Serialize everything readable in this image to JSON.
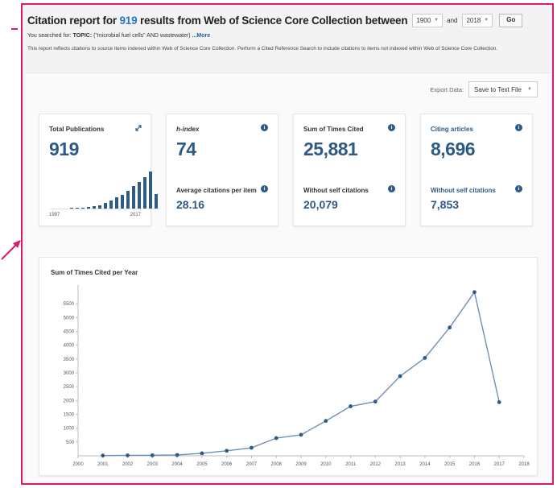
{
  "header": {
    "title_prefix": "Citation report for ",
    "result_count": "919",
    "title_suffix": " results from Web of Science Core Collection  between",
    "year_from": "1900",
    "and_label": "and",
    "year_to": "2018",
    "go_label": "Go",
    "searched_prefix": "You searched for: ",
    "searched_topic_label": "TOPIC:",
    "searched_query": " (\"microbial fuel cells\" AND wastewater) ",
    "more_label": "...More",
    "note": "This report reflects citations to source items indexed within Web of Science Core Collection. Perform a Cited Reference Search to include citations to items not indexed within Web of Science Core Collection."
  },
  "export": {
    "label": "Export Data:",
    "selected": "Save to Text File"
  },
  "cards": {
    "total_publications": {
      "label": "Total Publications",
      "value": "919",
      "year_start": "1997",
      "year_end": "2017",
      "spark_values": [
        2,
        1,
        3,
        4,
        6,
        9,
        16,
        22,
        30,
        38,
        47,
        60,
        72,
        84,
        100,
        40
      ]
    },
    "h_index": {
      "label": "h-index",
      "value": "74",
      "sub_label": "Average citations per item",
      "sub_value": "28.16"
    },
    "sum_cited": {
      "label": "Sum of Times Cited",
      "value": "25,881",
      "sub_label": "Without self citations",
      "sub_value": "20,079"
    },
    "citing_articles": {
      "label": "Citing articles",
      "value": "8,696",
      "sub_label": "Without self citations",
      "sub_value": "7,853"
    }
  },
  "colors": {
    "accent": "#2e5a86",
    "link": "#2a76c6",
    "frame": "#d81b6a",
    "line": "#6f8fb5"
  },
  "chart_data": {
    "type": "line",
    "title": "Sum of Times Cited per Year",
    "x": [
      2001,
      2002,
      2003,
      2004,
      2005,
      2006,
      2007,
      2008,
      2009,
      2010,
      2011,
      2012,
      2013,
      2014,
      2015,
      2016,
      2017
    ],
    "series": [
      {
        "values": [
          10,
          15,
          18,
          30,
          90,
          180,
          290,
          640,
          760,
          1260,
          1790,
          1960,
          2880,
          3540,
          4640,
          5920,
          1940
        ]
      }
    ],
    "xticks": [
      2000,
      2001,
      2002,
      2003,
      2004,
      2005,
      2006,
      2007,
      2008,
      2009,
      2010,
      2011,
      2012,
      2013,
      2014,
      2015,
      2016,
      2017,
      2018
    ],
    "yticks": [
      500,
      1000,
      1500,
      2000,
      2500,
      3000,
      3500,
      4000,
      4500,
      5000,
      5500
    ],
    "xlim": [
      2000,
      2018
    ],
    "ylim": [
      0,
      6000
    ],
    "xlabel": "",
    "ylabel": "",
    "grid": false
  }
}
